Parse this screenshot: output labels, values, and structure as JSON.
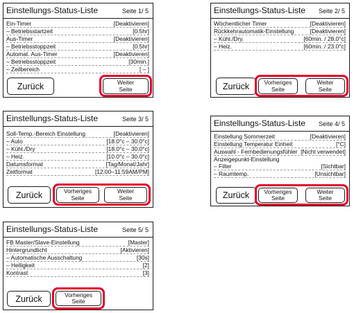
{
  "screens": [
    {
      "title": "Einstellungs-Status-Liste",
      "page": "Seite  1/ 5",
      "rows": [
        {
          "k": "Ein-Timer",
          "v": "[Deaktivieren]"
        },
        {
          "k": "– Betriebsstartzeit",
          "v": "[0.5hr]"
        },
        {
          "k": "Aus-Timer",
          "v": "[Deaktivieren]"
        },
        {
          "k": "– Betriebsstoppzeit",
          "v": "[0.5hr]"
        },
        {
          "k": "Automat. Aus-Timer",
          "v": "[Deaktivieren]"
        },
        {
          "k": "– Betriebsstoppzeit",
          "v": "[30min.]"
        },
        {
          "k": "– Zeilbereich",
          "v": "[ – ]"
        }
      ],
      "back": "Zurück",
      "next": [
        "Weiter",
        "Seite"
      ]
    },
    {
      "title": "Einstellungs-Status-Liste",
      "page": "Seite  2/ 5",
      "rows": [
        {
          "k": "Wöchentlicher Timer",
          "v": "[Deaktivieren]"
        },
        {
          "k": "Rückkehrautomatik-Einstellung",
          "v": "[Deaktivieren]"
        },
        {
          "k": "– Kühl./Dry.",
          "v": "[60min. / 28.0°c]"
        },
        {
          "k": "– Heiz.",
          "v": "[60min. / 23.0°c]"
        }
      ],
      "back": "Zurück",
      "prev": [
        "Vorheriges",
        "Seite"
      ],
      "next": [
        "Weiter",
        "Seite"
      ]
    },
    {
      "title": "Einstellungs-Status-Liste",
      "page": "Seite  3/ 5",
      "rows": [
        {
          "k": "Soll-Temp.-Bereich Einstellung",
          "v": "[Deaktivieren]"
        },
        {
          "k": "– Auto",
          "v": "[18.0°c – 30.0°c]"
        },
        {
          "k": "– Kühl./Dry",
          "v": "[18.0°c – 30.0°c]"
        },
        {
          "k": "– Heiz.",
          "v": "[10.0°c – 30.0°c]"
        },
        {
          "k": "Datumsformat",
          "v": "[Tag/Monat/Jahr]"
        },
        {
          "k": "Zeitformat",
          "v": "[12:00–11:59AM/PM]"
        }
      ],
      "back": "Zurück",
      "prev": [
        "Vorheriges",
        "Seite"
      ],
      "next": [
        "Weiter",
        "Seite"
      ]
    },
    {
      "title": "Einstellungs-Status-Liste",
      "page": "Seite  4/ 5",
      "rows": [
        {
          "k": "Einstellung Sommerzeit",
          "v": "[Deaktivieren]"
        },
        {
          "k": "Einstellung Temperatur Einheit",
          "v": "[°C]"
        },
        {
          "k": "Auswahl - Fernbedienungsfühler",
          "v": "[Nicht verwendet]"
        },
        {
          "k": "Anzeigepunkt-Einstellung",
          "v": ""
        },
        {
          "k": "– Filter",
          "v": "[Sichtbar]"
        },
        {
          "k": "– Raumtemp.",
          "v": "[Unsichtbar]"
        }
      ],
      "back": "Zurück",
      "prev": [
        "Vorheriges",
        "Seite"
      ],
      "next": [
        "Weiter",
        "Seite"
      ]
    },
    {
      "title": "Einstellungs-Status-Liste",
      "page": "Seite  5/ 5",
      "rows": [
        {
          "k": "FB Master/Slave-Einstellung",
          "v": "[Master]"
        },
        {
          "k": "Hintergrundlicht",
          "v": "[Aktivieren]"
        },
        {
          "k": "– Automatische Ausschaltung",
          "v": "[30s]"
        },
        {
          "k": "– Helligkeit",
          "v": "[2]"
        },
        {
          "k": "Kontrast",
          "v": "[3]"
        }
      ],
      "back": "Zurück",
      "prev": [
        "Vorheriges",
        "Seite"
      ]
    }
  ]
}
